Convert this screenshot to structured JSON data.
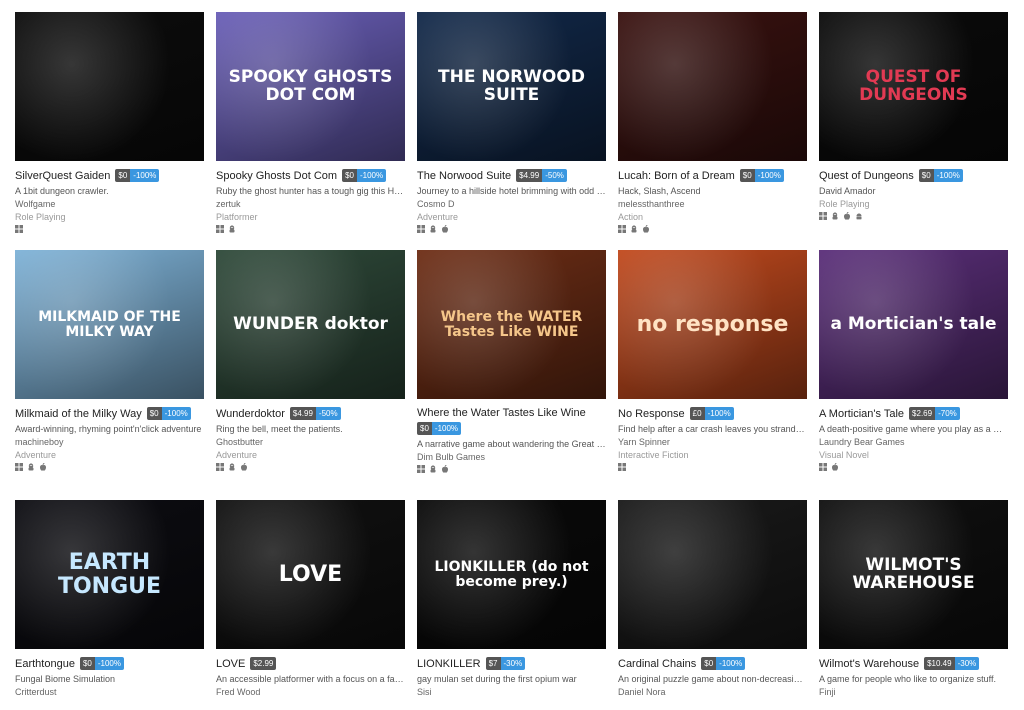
{
  "games": [
    {
      "title": "SilverQuest Gaiden",
      "price": "$0",
      "discount": "-100%",
      "desc": "A 1bit dungeon crawler.",
      "author": "Wolfgame",
      "genre": "Role Playing",
      "platforms": [
        "windows"
      ],
      "cover": {
        "bg": "#0d0d0d",
        "fg": "#ffffff",
        "text": ""
      }
    },
    {
      "title": "Spooky Ghosts Dot Com",
      "price": "$0",
      "discount": "-100%",
      "desc": "Ruby the ghost hunter has a tough gig this Hall...",
      "author": "zertuk",
      "genre": "Platformer",
      "platforms": [
        "windows",
        "linux"
      ],
      "cover": {
        "bg": "#6a5fb8",
        "fg": "#ffffff",
        "text": "SPOOKY GHOSTS DOT COM"
      }
    },
    {
      "title": "The Norwood Suite",
      "price": "$4.99",
      "discount": "-50%",
      "desc": "Journey to a hillside hotel brimming with odd c...",
      "author": "Cosmo D",
      "genre": "Adventure",
      "platforms": [
        "windows",
        "linux",
        "mac"
      ],
      "cover": {
        "bg": "#12294a",
        "fg": "#ffffff",
        "text": "THE NORWOOD SUITE"
      }
    },
    {
      "title": "Lucah: Born of a Dream",
      "price": "$0",
      "discount": "-100%",
      "desc": "Hack, Slash, Ascend",
      "author": "melessthanthree",
      "genre": "Action",
      "platforms": [
        "windows",
        "linux",
        "mac"
      ],
      "cover": {
        "bg": "#3a1210",
        "fg": "#ffb27a",
        "text": ""
      }
    },
    {
      "title": "Quest of Dungeons",
      "price": "$0",
      "discount": "-100%",
      "desc": "David Amador",
      "author": "",
      "genre": "Role Playing",
      "platforms": [
        "windows",
        "linux",
        "mac",
        "android"
      ],
      "cover": {
        "bg": "#0b0b0b",
        "fg": "#e23a53",
        "text": "QUEST OF DUNGEONS"
      }
    },
    {
      "title": "Milkmaid of the Milky Way",
      "price": "$0",
      "discount": "-100%",
      "desc": "Award-winning, rhyming point'n'click adventure",
      "author": "machineboy",
      "genre": "Adventure",
      "platforms": [
        "windows",
        "linux",
        "mac"
      ],
      "cover": {
        "bg": "#7fb3d8",
        "fg": "#ffffff",
        "text": "MILKMAID OF THE MILKY WAY"
      }
    },
    {
      "title": "Wunderdoktor",
      "price": "$4.99",
      "discount": "-50%",
      "desc": "Ring the bell, meet the patients.",
      "author": "Ghostbutter",
      "genre": "Adventure",
      "platforms": [
        "windows",
        "linux",
        "mac"
      ],
      "cover": {
        "bg": "#2f4a3a",
        "fg": "#ffffff",
        "text": "WUNDER doktor"
      }
    },
    {
      "title": "Where the Water Tastes Like Wine",
      "price": "$0",
      "discount": "-100%",
      "desc": "A narrative game about wandering the Great D...",
      "author": "Dim Bulb Games",
      "genre": "",
      "platforms": [
        "windows",
        "linux",
        "mac"
      ],
      "cover": {
        "bg": "#6e2e16",
        "fg": "#f5c68a",
        "text": "Where the WATER Tastes Like WINE"
      }
    },
    {
      "title": "No Response",
      "price": "£0",
      "discount": "-100%",
      "desc": "Find help after a car crash leaves you stranded ...",
      "author": "Yarn Spinner",
      "genre": "Interactive Fiction",
      "platforms": [
        "windows"
      ],
      "cover": {
        "bg": "#c24a1e",
        "fg": "#ffe3c4",
        "text": "no response"
      }
    },
    {
      "title": "A Mortician's Tale",
      "price": "$2.69",
      "discount": "-70%",
      "desc": "A death-positive game where you play as a mo...",
      "author": "Laundry Bear Games",
      "genre": "Visual Novel",
      "platforms": [
        "windows",
        "mac"
      ],
      "cover": {
        "bg": "#5b2f7a",
        "fg": "#ffffff",
        "text": "a Mortician's tale"
      }
    },
    {
      "title": "Earthtongue",
      "price": "$0",
      "discount": "-100%",
      "desc": "Fungal Biome Simulation",
      "author": "Critterdust",
      "genre": "",
      "platforms": [],
      "cover": {
        "bg": "#0d0d12",
        "fg": "#c6e8ff",
        "text": "EARTH TONGUE"
      }
    },
    {
      "title": "LOVE",
      "price": "$2.99",
      "discount": "",
      "desc": "An accessible platformer with a focus on a fair ...",
      "author": "Fred Wood",
      "genre": "",
      "platforms": [],
      "cover": {
        "bg": "#111111",
        "fg": "#ffffff",
        "text": "LOVE"
      }
    },
    {
      "title": "LIONKILLER",
      "price": "$7",
      "discount": "-30%",
      "desc": "gay mulan set during the first opium war",
      "author": "Sisi",
      "genre": "",
      "platforms": [],
      "cover": {
        "bg": "#0a0a0a",
        "fg": "#ffffff",
        "text": "LIONKILLER (do not become prey.)"
      }
    },
    {
      "title": "Cardinal Chains",
      "price": "$0",
      "discount": "-100%",
      "desc": "An original puzzle game about non-decreasing ...",
      "author": "Daniel Nora",
      "genre": "",
      "platforms": [],
      "cover": {
        "bg": "#1a1a1a",
        "fg": "#ffffff",
        "text": ""
      }
    },
    {
      "title": "Wilmot's Warehouse",
      "price": "$10.49",
      "discount": "-30%",
      "desc": "A game for people who like to organize stuff.",
      "author": "Finji",
      "genre": "",
      "platforms": [],
      "cover": {
        "bg": "#101010",
        "fg": "#ffffff",
        "text": "WILMOT'S WAREHOUSE"
      }
    }
  ]
}
